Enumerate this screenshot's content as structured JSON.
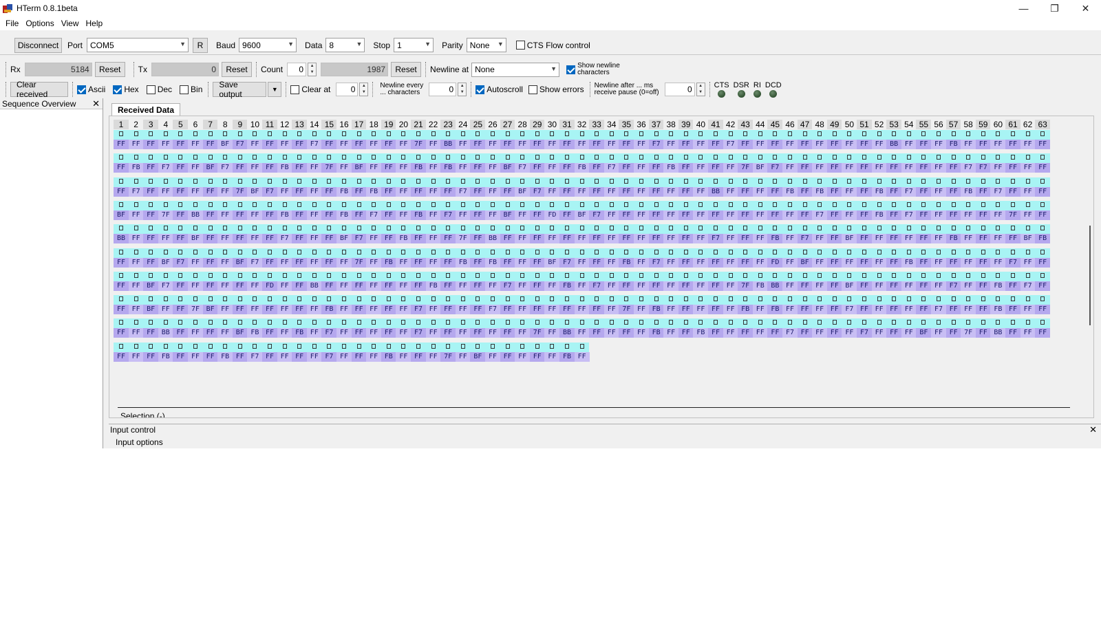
{
  "window": {
    "title": "HTerm 0.8.1beta",
    "minimize": "—",
    "maximize": "❐",
    "close": "✕"
  },
  "menu": [
    "File",
    "Options",
    "View",
    "Help"
  ],
  "connection": {
    "disconnect_label": "Disconnect",
    "port_label": "Port",
    "port_value": "COM5",
    "r_label": "R",
    "baud_label": "Baud",
    "baud_value": "9600",
    "data_label": "Data",
    "data_value": "8",
    "stop_label": "Stop",
    "stop_value": "1",
    "parity_label": "Parity",
    "parity_value": "None",
    "cts_label": "CTS Flow control"
  },
  "counters": {
    "rx_label": "Rx",
    "rx_value": "5184",
    "rx_reset": "Reset",
    "tx_label": "Tx",
    "tx_value": "0",
    "tx_reset": "Reset",
    "count_label": "Count",
    "count_value": "0",
    "count_total": "1987",
    "count_reset": "Reset",
    "newline_label": "Newline at",
    "newline_value": "None",
    "show_newline_line1": "Show newline",
    "show_newline_line2": "characters"
  },
  "options": {
    "clear_received": "Clear received",
    "ascii": "Ascii",
    "hex": "Hex",
    "dec": "Dec",
    "bin": "Bin",
    "save_output": "Save output",
    "clear_at": "Clear at",
    "clear_at_value": "0",
    "newline_every_line1": "Newline every",
    "newline_every_line2": "... characters",
    "newline_every_value": "0",
    "autoscroll": "Autoscroll",
    "show_errors": "Show errors",
    "newline_after_line1": "Newline after ... ms",
    "newline_after_line2": "receive pause (0=off)",
    "newline_after_value": "0",
    "leds": [
      "CTS",
      "DSR",
      "RI",
      "DCD"
    ]
  },
  "sequence": {
    "title": "Sequence Overview",
    "close": "✕"
  },
  "received": {
    "tab": "Received Data",
    "selection": "Selection (-)",
    "rows": [
      "FF FF FF FF FF FF FF BF F7 FF FF FF FF F7 FF FF FF FF FF FF 7F FF BB FF FF FF FF FF FF FF FF FF FF FF FF FF F7 FF FF FF FF F7 FF FF FF FF FF FF FF FF FF FF BB FF FF FF FB FF FF FF FF FF FF",
      "FF FB FF F7 FF FF BF F7 FF FF FF FB FF FF 7F FF BF FF FF FF FB FF FB FF FF FF BF F7 FF FF FF FB FF F7 FF FF FF FB FF FF FF FF 7F BF F7 FF FF FF FF FF FF FF FF FF FF FF FF F7 F7 FF FF FF FF",
      "FF F7 FF FF FF FF FF FF 7F BF F7 FF FF FF FF FB FF FB FF FF FF FF FF F7 FF FF FF BF F7 FF FF FF FF FF FF FF FF FF FF FF BB FF FF FF FF FB FF FB FF FF FF FB FF F7 FF FF FF FB FF F7 FF FF FF",
      "BF FF FF 7F FF BB FF FF FF FF FF FB FF FF FF FB FF F7 FF FF FB FF F7 FF FF FF BF FF FF FD FF BF F7 FF FF FF FF FF FF FF FF FF FF FF FF FF FF F7 FF FF FF FB FF F7 FF FF FF FF FF FF 7F FF FF",
      "BB FF FF FF FF BF FF FF FF FF FF F7 FF FF FF BF F7 FF FF FB FF FF FF 7F FF BB FF FF FF FF FF FF FF FF FF FF FF FF FF FF F7 FF FF FF FB FF F7 FF FF BF FF FF FF FF FF FF FB FF FF FF FF BF FB",
      "FF FF FF BF F7 FF FF FF BF F7 FF FF FF FF FF FF 7F FF FB FF FF FF FF FB FF FB FF FF FF BF F7 FF FF FF FB FF F7 FF FF FF FF FF FF FF FD FF BF FF FF FF FF FF FF FB FF FF FF FF FF FF F7 FF FF",
      "FF FF BF F7 FF FF FF FF FF FF FD FF FF BB FF FF FF FF FF FF FF FB FF FF FF FF F7 FF FF FF FB FF F7 FF FF FF FF FF FF FF FF FF 7F FB BB FF FF FF FF BF FF FF FF FF FF FF F7 FF FF FB FF F7 FF",
      "FF FF BF FF FF 7F BF FF FF FF FF FF FF FF FB FF FF FF FF FF F7 FF FF FF FF F7 FF FF FF FF FF FF FF FF 7F FF FB FF FF FF FF FF FB FF FB FF FF FF FF F7 FF FF FF FF FF F7 FF FF FF FB FF FF FF",
      "FF FF FF BB FF FF FF FF BF FB FF FF FB FF F7 FF FF FF FF FF F7 FF FF FF FF FF FF FF 7F FF BB FF FF FF FF FF FB FF FF FB FF FF FF FF FF F7 FF FF FF FF F7 FF FF FF BF FF FF 7F FF BB FF FF FF",
      "FF FF FF FB FF FF FF FB FF F7 FF FF FF FF F7 FF FF FF FB FF FF FF 7F FF BF FF FF FF FF FF FB FF"
    ]
  },
  "input": {
    "title": "Input control",
    "close": "✕",
    "options_label": "Input options"
  }
}
